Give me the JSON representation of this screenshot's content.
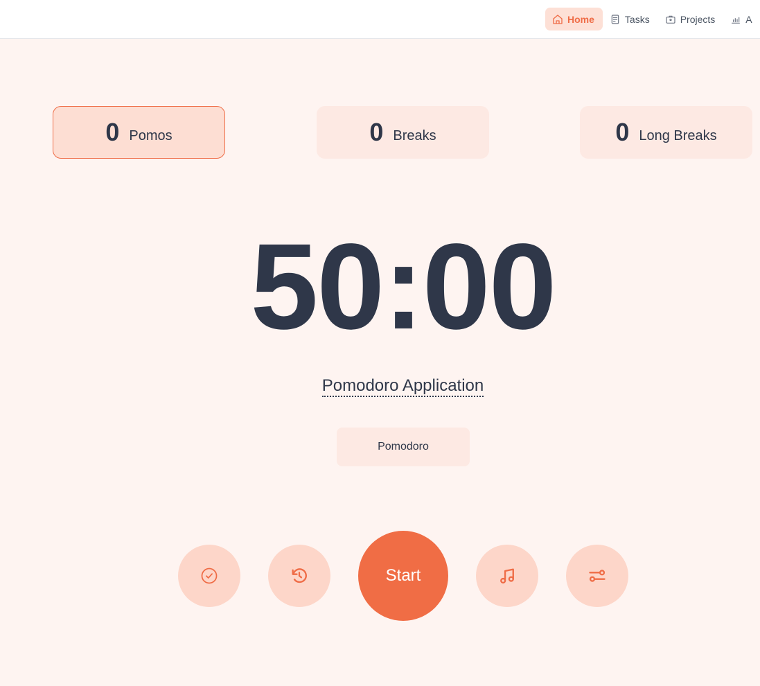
{
  "nav": {
    "items": [
      {
        "label": "Home",
        "icon": "home-icon",
        "active": true
      },
      {
        "label": "Tasks",
        "icon": "tasks-icon",
        "active": false
      },
      {
        "label": "Projects",
        "icon": "briefcase-icon",
        "active": false
      },
      {
        "label": "A",
        "icon": "analytics-icon",
        "active": false
      }
    ]
  },
  "stats": [
    {
      "count": "0",
      "label": "Pomos"
    },
    {
      "count": "0",
      "label": "Breaks"
    },
    {
      "count": "0",
      "label": "Long Breaks"
    }
  ],
  "timer": {
    "display": "50:00"
  },
  "project": {
    "name": "Pomodoro Application"
  },
  "mode": {
    "label": "Pomodoro"
  },
  "controls": {
    "start_label": "Start",
    "icons": [
      "check-circle-icon",
      "reset-icon",
      "music-icon",
      "settings-sliders-icon"
    ]
  },
  "colors": {
    "accent": "#f06d45",
    "accent_soft": "#fdd6c9",
    "text": "#2f3749",
    "background": "#fef4f1"
  }
}
